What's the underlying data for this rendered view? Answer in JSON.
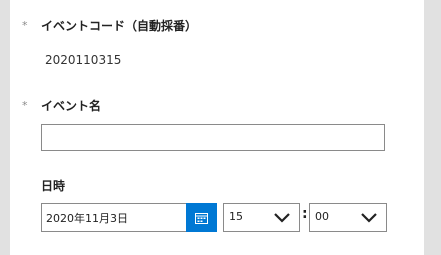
{
  "event_code": {
    "required_mark": "*",
    "label": "イベントコード（自動採番）",
    "value": "2020110315"
  },
  "event_name": {
    "required_mark": "*",
    "label": "イベント名",
    "value": ""
  },
  "datetime": {
    "label": "日時",
    "date": "2020年11月3日",
    "hour": "15",
    "separator": ":",
    "minute": "00"
  },
  "colors": {
    "accent": "#0078d4",
    "background": "#e1e1e1",
    "card": "#ffffff"
  },
  "icons": {
    "calendar": "calendar-icon",
    "dropdown": "chevron-down-icon"
  }
}
